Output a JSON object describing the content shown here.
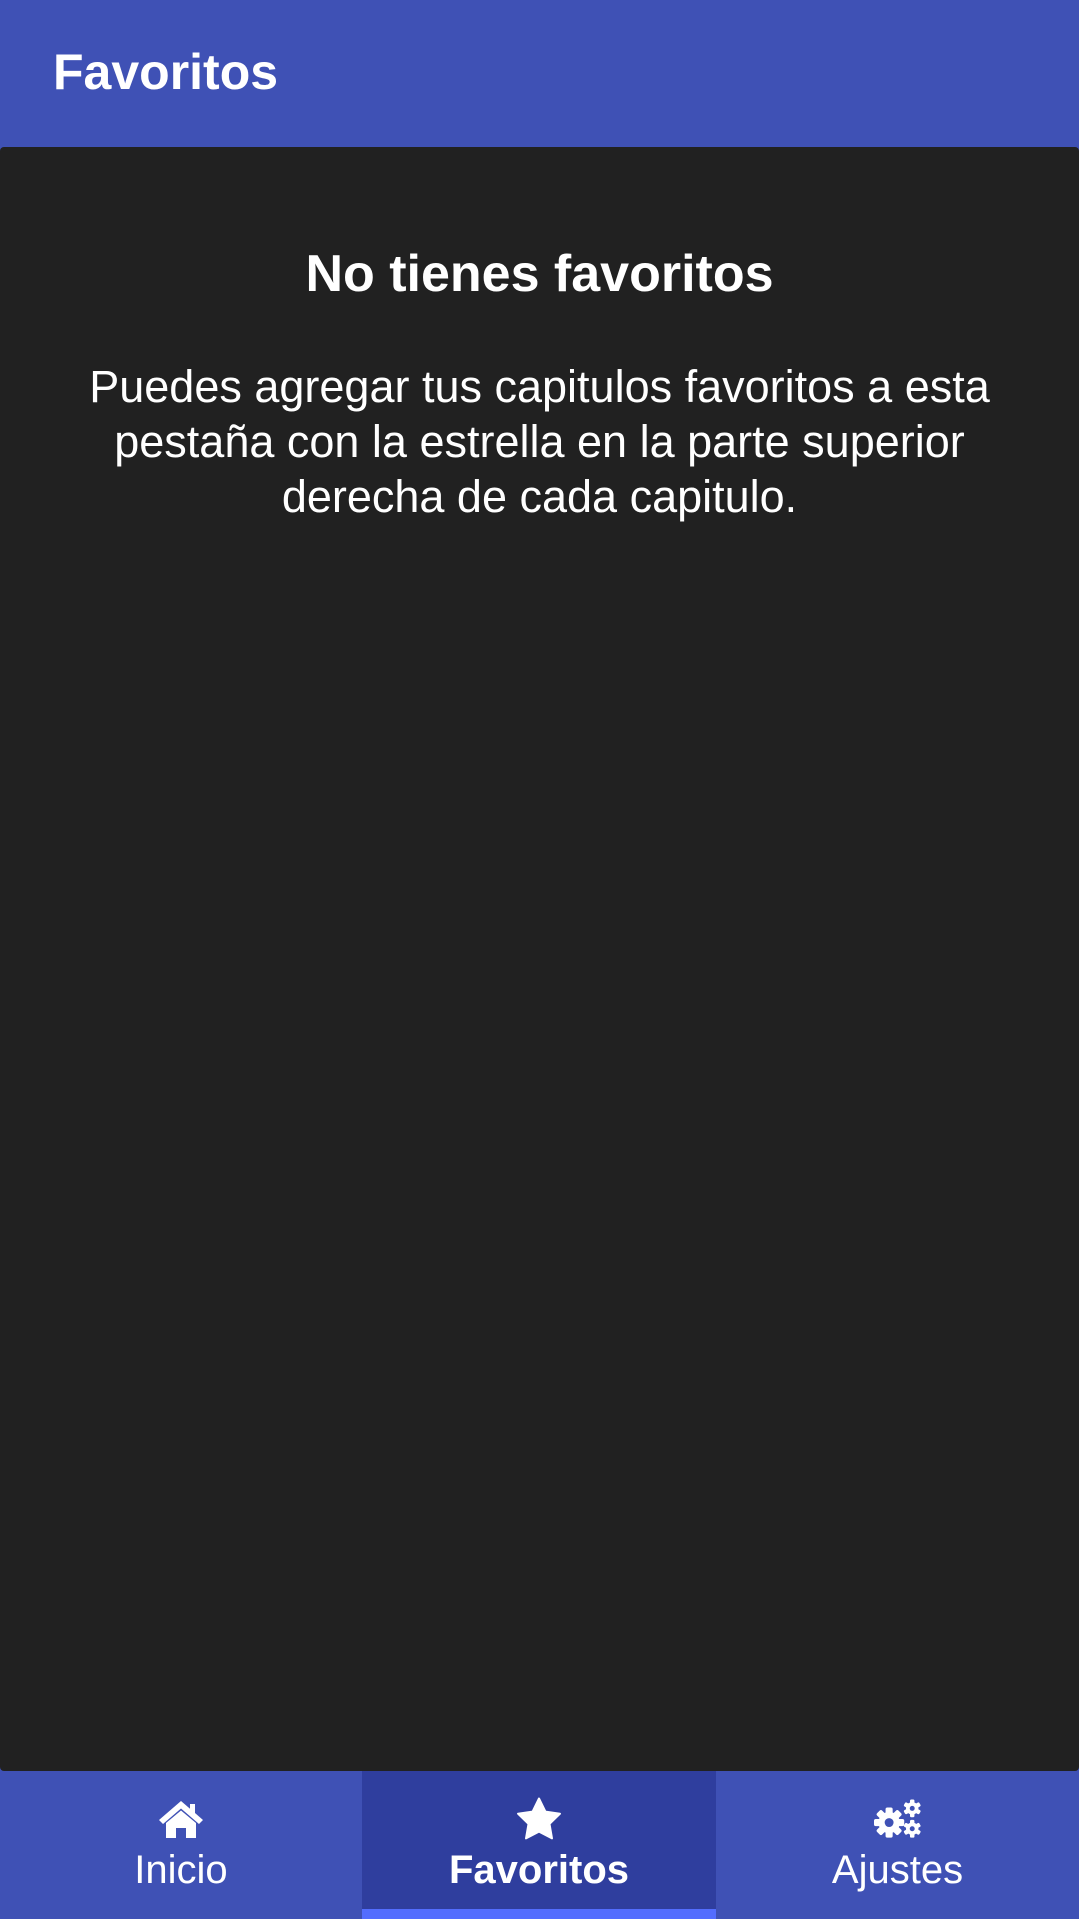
{
  "header": {
    "title": "Favoritos"
  },
  "empty_state": {
    "title": "No tienes favoritos",
    "message": "Puedes agregar tus capitulos favoritos a esta pestaña con la estrella en la parte superior derecha de cada capitulo."
  },
  "bottom_nav": {
    "items": [
      {
        "label": "Inicio",
        "icon": "home-icon",
        "active": false
      },
      {
        "label": "Favoritos",
        "icon": "star-icon",
        "active": true
      },
      {
        "label": "Ajustes",
        "icon": "gears-icon",
        "active": false
      }
    ]
  },
  "colors": {
    "primary": "#3f51b5",
    "primary_dark": "#2f3e9e",
    "accent": "#536dfe",
    "background": "#212121",
    "text": "#ffffff"
  }
}
